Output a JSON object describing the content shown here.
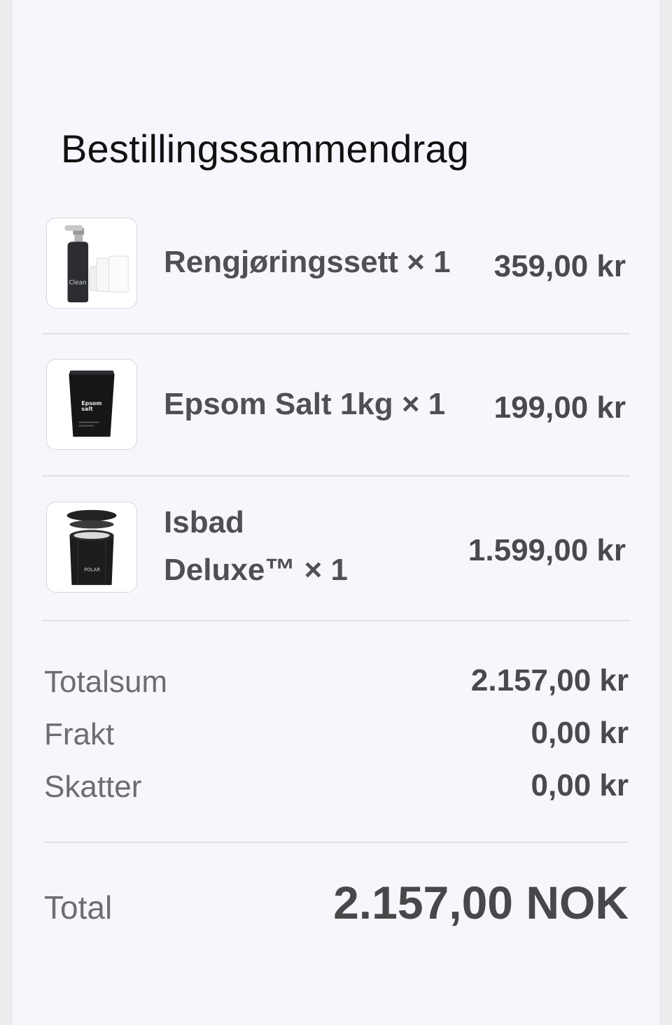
{
  "summary": {
    "title": "Bestillingssammendrag",
    "items": [
      {
        "name": "Rengjøringssett × 1",
        "price": "359,00 kr",
        "icon": "cleaning-kit-image"
      },
      {
        "name_line1": "Epsom Salt 1kg × 1",
        "price": "199,00 kr",
        "icon": "epsom-salt-image"
      },
      {
        "name_line1": "Isbad",
        "name_line2": "Deluxe™ × 1",
        "price": "1.599,00 kr",
        "icon": "ice-bath-image"
      }
    ],
    "subtotal_label": "Totalsum",
    "subtotal_value": "2.157,00 kr",
    "shipping_label": "Frakt",
    "shipping_value": "0,00 kr",
    "taxes_label": "Skatter",
    "taxes_value": "0,00 kr",
    "total_label": "Total",
    "total_value": "2.157,00 NOK"
  },
  "thumb_text": {
    "clean": "Clean",
    "epsom": "Epsom",
    "salt": "salt",
    "polar": "POLAR"
  }
}
